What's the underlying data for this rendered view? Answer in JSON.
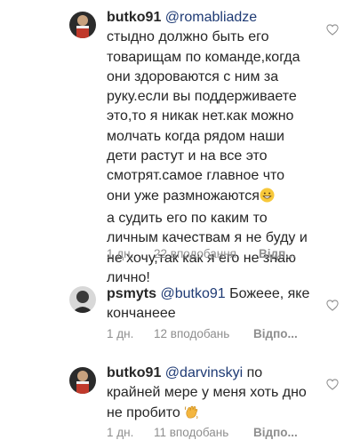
{
  "comments": [
    {
      "username": "butko91",
      "mention": "@romabliadze",
      "lines": [
        "стыдно должно быть его",
        "товарищам по команде,когда",
        "они здороваются с ним за",
        "руку.если вы поддерживаете",
        "это,то я никак нет.как можно",
        "молчать когда рядом наши",
        "дети растут и на все это",
        "смотрят.самое главное что",
        "они уже размножаются",
        "а судить его по каким то",
        "личным качествам я не буду и",
        "не хочу,так как я его не знаю",
        "лично!"
      ],
      "emoji": "grinning-face-emoji",
      "time": "1 дн.",
      "likes": "22 вподобання",
      "reply": "Відп..."
    },
    {
      "username": "psmyts",
      "mention": "@butko91",
      "first_line_rest": "Божеее, яке",
      "lines": [
        "кончанееe"
      ],
      "time": "1 дн.",
      "likes": "12 вподобань",
      "reply": "Відпо..."
    },
    {
      "username": "butko91",
      "mention": "@darvinskyi",
      "first_line_rest": "по",
      "lines": [
        "крайней мере у меня хоть дно",
        "не пробито"
      ],
      "emoji": "waving-hand-emoji",
      "time": "1 дн.",
      "likes": "11 вподобань",
      "reply": "Відпо..."
    }
  ],
  "icons": {
    "heart": "heart-outline-icon"
  },
  "colors": {
    "text": "#262626",
    "mention": "#1e3a74",
    "meta": "#8e8e8e"
  }
}
